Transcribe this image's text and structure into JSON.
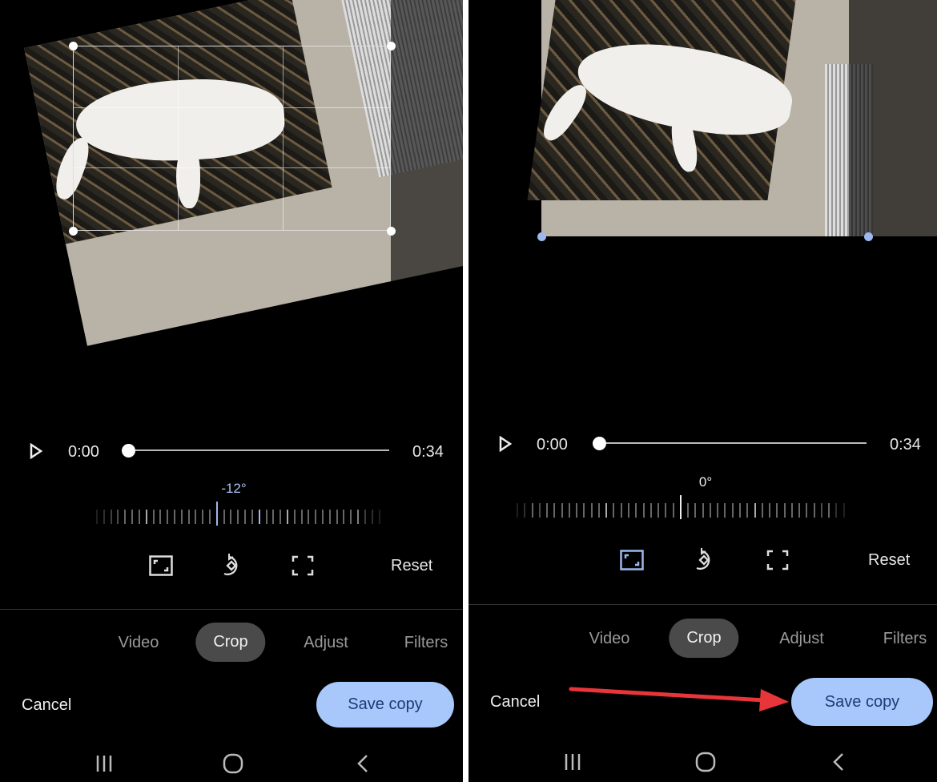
{
  "panels": [
    {
      "time_start": "0:00",
      "time_end": "0:34",
      "rotation": "-12°",
      "reset": "Reset",
      "tabs": [
        "Video",
        "Crop",
        "Adjust",
        "Filters"
      ],
      "active_tab": "Crop",
      "cancel": "Cancel",
      "save": "Save copy",
      "progress": 0
    },
    {
      "time_start": "0:00",
      "time_end": "0:34",
      "rotation": "0°",
      "reset": "Reset",
      "tabs": [
        "Video",
        "Crop",
        "Adjust",
        "Filters"
      ],
      "active_tab": "Crop",
      "cancel": "Cancel",
      "save": "Save copy",
      "progress": 0
    }
  ],
  "colors": {
    "accent": "#a8c7fa",
    "arrow": "#e8353a",
    "background": "#000000"
  },
  "icons": [
    "play-icon",
    "aspect-ratio-icon",
    "rotate-icon",
    "free-crop-icon",
    "recents-icon",
    "home-icon",
    "back-icon"
  ]
}
